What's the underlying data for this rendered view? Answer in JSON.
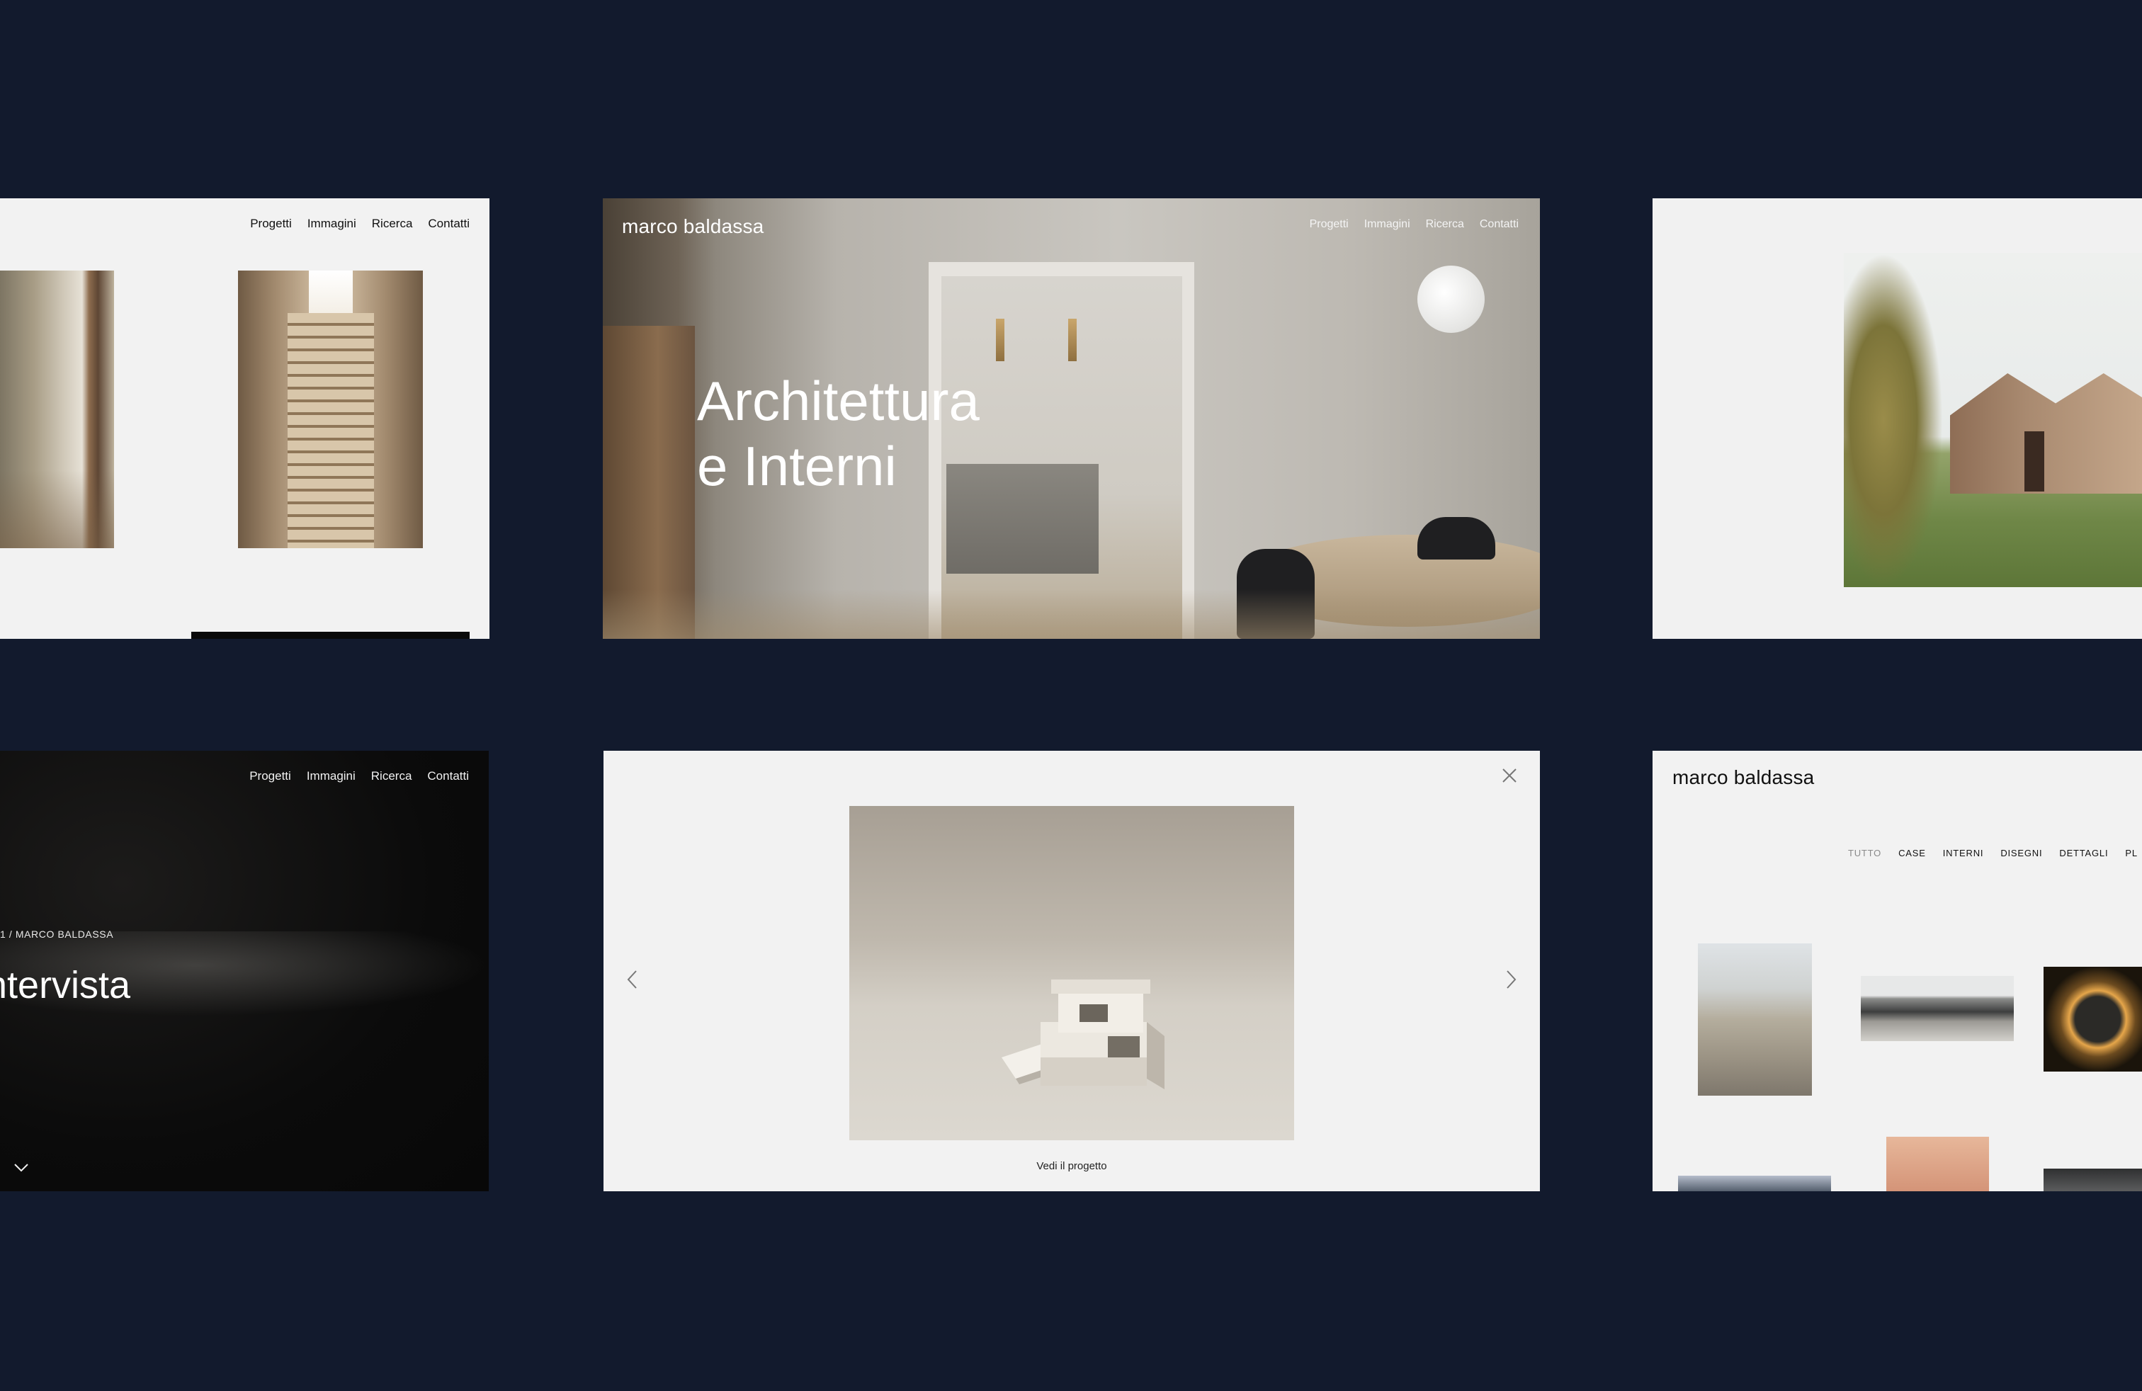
{
  "nav": {
    "progetti": "Progetti",
    "immagini": "Immagini",
    "ricerca": "Ricerca",
    "contatti": "Contatti"
  },
  "brand": {
    "name": "marco baldassa"
  },
  "hero": {
    "line1": "Architettura",
    "line2": "e Interni"
  },
  "article": {
    "breadcrumb": "1  /  MARCO BALDASSA",
    "title": "ntervista"
  },
  "lightbox": {
    "caption": "Vedi il progetto"
  },
  "filters": {
    "tutto": "TUTTO",
    "case": "CASE",
    "interni": "INTERNI",
    "disegni": "DISEGNI",
    "dettagli": "DETTAGLI",
    "more": "PL"
  },
  "colors": {
    "background": "#121a2d",
    "card_light": "#f2f2f2",
    "card_dark": "#0b0b0b"
  }
}
